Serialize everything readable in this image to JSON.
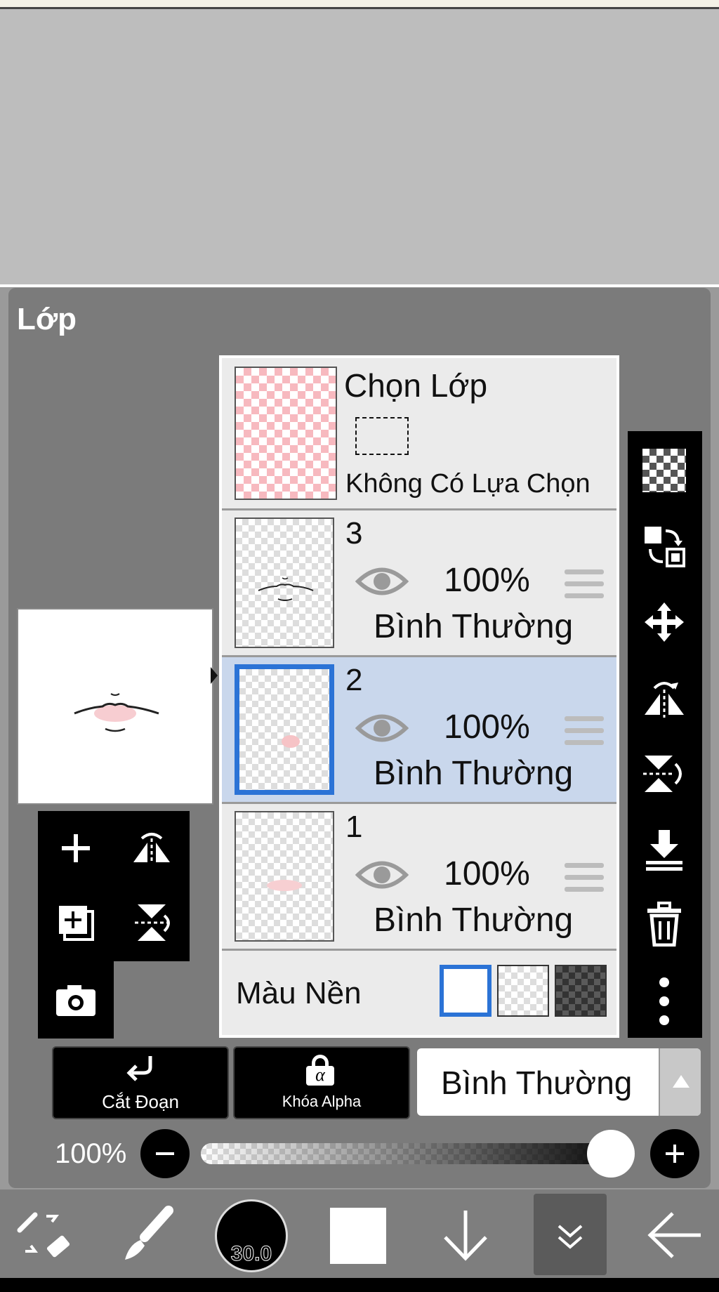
{
  "panel": {
    "title": "Lớp"
  },
  "selection_layer": {
    "title": "Chọn Lớp",
    "subtitle": "Không Có Lựa Chọn"
  },
  "layers": [
    {
      "number": "3",
      "opacity": "100%",
      "blend": "Bình Thường",
      "selected": false
    },
    {
      "number": "2",
      "opacity": "100%",
      "blend": "Bình Thường",
      "selected": true
    },
    {
      "number": "1",
      "opacity": "100%",
      "blend": "Bình Thường",
      "selected": false
    }
  ],
  "background": {
    "label": "Màu Nền",
    "options": [
      "white",
      "transparent",
      "dark"
    ],
    "selected": "white"
  },
  "bottom_controls": {
    "clipping_label": "Cắt Đoạn",
    "alpha_lock_label": "Khóa Alpha",
    "alpha_lock_symbol": "α",
    "blend_mode": "Bình Thường",
    "opacity_label": "100%",
    "opacity_value": 1.0
  },
  "toolbar": {
    "brush_size": "30.0"
  },
  "icons": {
    "right": [
      "checker-icon",
      "swap-icon",
      "move-icon",
      "flip-horizontal-icon",
      "flip-vertical-icon",
      "merge-down-icon",
      "trash-icon",
      "more-icon"
    ],
    "left": [
      "add-layer-icon",
      "flip-h-icon",
      "add-copy-icon",
      "flip-v-icon",
      "camera-icon"
    ],
    "bottom": [
      "tool-switch-icon",
      "brush-icon",
      "brush-size-icon",
      "color-icon",
      "down-arrow-icon",
      "collapse-icon",
      "back-arrow-icon"
    ]
  },
  "colors": {
    "accent": "#2b73d6",
    "panel": "#7a7a7a",
    "selected_row": "#c9d7ec"
  }
}
